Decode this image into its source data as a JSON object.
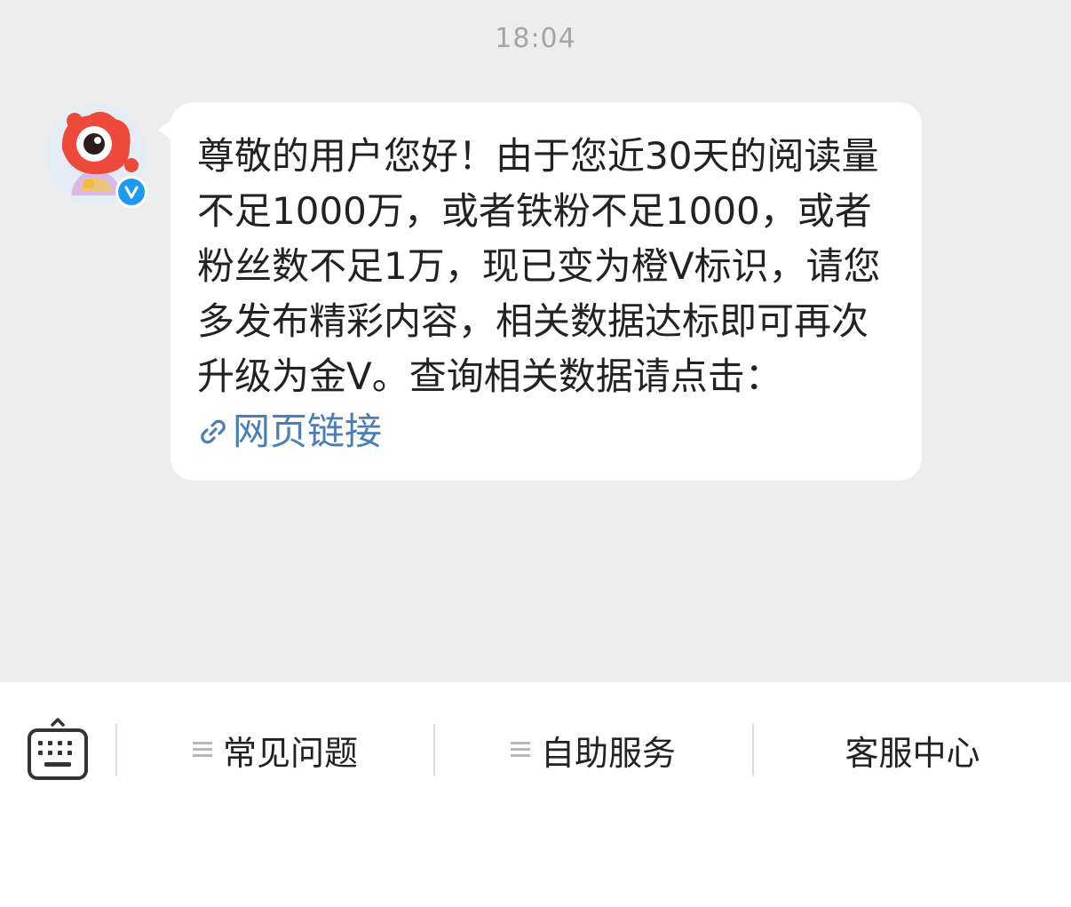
{
  "timestamp": "18:04",
  "sender": {
    "avatar_icon": "weibo-mascot-avatar",
    "verified_badge": "V"
  },
  "message": {
    "text": "尊敬的用户您好！由于您近30天的阅读量不足1000万，或者铁粉不足1000，或者粉丝数不足1万，现已变为橙V标识，请您多发布精彩内容，相关数据达标即可再次升级为金V。查询相关数据请点击：",
    "link_icon": "link-icon",
    "link_text": "网页链接",
    "link_color": "#4a7eb8"
  },
  "bottom_menu": {
    "keyboard_icon": "keyboard-icon",
    "items": [
      {
        "label": "常见问题",
        "has_menu_icon": true
      },
      {
        "label": "自助服务",
        "has_menu_icon": true
      },
      {
        "label": "客服中心",
        "has_menu_icon": false
      }
    ]
  },
  "colors": {
    "chat_background": "#ededed",
    "bubble_background": "#ffffff",
    "verified_blue": "#1d9bf0",
    "mascot_red": "#ee4a3c"
  }
}
